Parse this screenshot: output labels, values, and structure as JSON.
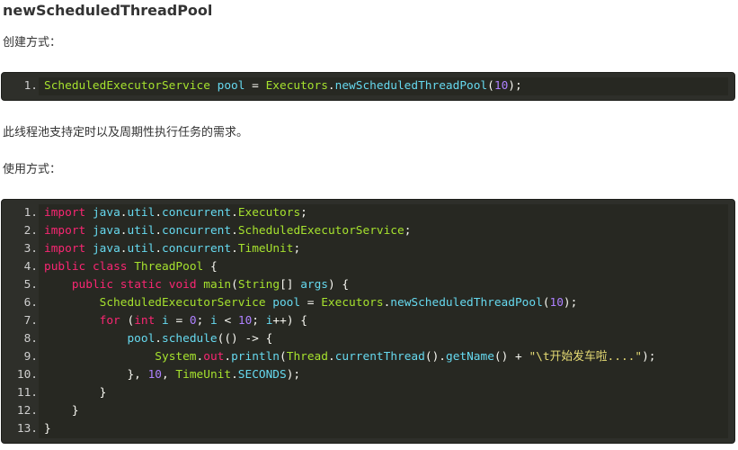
{
  "heading": "newScheduledThreadPool",
  "label_create": "创建方式：",
  "description": "此线程池支持定时以及周期性执行任务的需求。",
  "label_usage": "使用方式：",
  "snippet1": [
    {
      "no": "1.",
      "tokens": [
        {
          "t": "ScheduledExecutorService",
          "c": "type"
        },
        {
          "t": " ",
          "c": "plain"
        },
        {
          "t": "pool",
          "c": "var"
        },
        {
          "t": " = ",
          "c": "plain"
        },
        {
          "t": "Executors",
          "c": "type"
        },
        {
          "t": ".",
          "c": "plain"
        },
        {
          "t": "newScheduledThreadPool",
          "c": "var"
        },
        {
          "t": "(",
          "c": "plain"
        },
        {
          "t": "10",
          "c": "num"
        },
        {
          "t": ");",
          "c": "plain"
        }
      ]
    }
  ],
  "snippet2": [
    {
      "no": "1.",
      "tokens": [
        {
          "t": "import",
          "c": "kw"
        },
        {
          "t": " ",
          "c": "plain"
        },
        {
          "t": "java",
          "c": "var"
        },
        {
          "t": ".",
          "c": "plain"
        },
        {
          "t": "util",
          "c": "var"
        },
        {
          "t": ".",
          "c": "plain"
        },
        {
          "t": "concurrent",
          "c": "var"
        },
        {
          "t": ".",
          "c": "plain"
        },
        {
          "t": "Executors",
          "c": "type"
        },
        {
          "t": ";",
          "c": "plain"
        }
      ]
    },
    {
      "no": "2.",
      "tokens": [
        {
          "t": "import",
          "c": "kw"
        },
        {
          "t": " ",
          "c": "plain"
        },
        {
          "t": "java",
          "c": "var"
        },
        {
          "t": ".",
          "c": "plain"
        },
        {
          "t": "util",
          "c": "var"
        },
        {
          "t": ".",
          "c": "plain"
        },
        {
          "t": "concurrent",
          "c": "var"
        },
        {
          "t": ".",
          "c": "plain"
        },
        {
          "t": "ScheduledExecutorService",
          "c": "type"
        },
        {
          "t": ";",
          "c": "plain"
        }
      ]
    },
    {
      "no": "3.",
      "tokens": [
        {
          "t": "import",
          "c": "kw"
        },
        {
          "t": " ",
          "c": "plain"
        },
        {
          "t": "java",
          "c": "var"
        },
        {
          "t": ".",
          "c": "plain"
        },
        {
          "t": "util",
          "c": "var"
        },
        {
          "t": ".",
          "c": "plain"
        },
        {
          "t": "concurrent",
          "c": "var"
        },
        {
          "t": ".",
          "c": "plain"
        },
        {
          "t": "TimeUnit",
          "c": "type"
        },
        {
          "t": ";",
          "c": "plain"
        }
      ]
    },
    {
      "no": "4.",
      "tokens": [
        {
          "t": "public",
          "c": "kw"
        },
        {
          "t": " ",
          "c": "plain"
        },
        {
          "t": "class",
          "c": "kw"
        },
        {
          "t": " ",
          "c": "plain"
        },
        {
          "t": "ThreadPool",
          "c": "type"
        },
        {
          "t": " {",
          "c": "plain"
        }
      ]
    },
    {
      "no": "5.",
      "tokens": [
        {
          "t": "    ",
          "c": "plain"
        },
        {
          "t": "public",
          "c": "kw"
        },
        {
          "t": " ",
          "c": "plain"
        },
        {
          "t": "static",
          "c": "kw"
        },
        {
          "t": " ",
          "c": "plain"
        },
        {
          "t": "void",
          "c": "kw"
        },
        {
          "t": " ",
          "c": "plain"
        },
        {
          "t": "main",
          "c": "type"
        },
        {
          "t": "(",
          "c": "plain"
        },
        {
          "t": "String",
          "c": "type"
        },
        {
          "t": "[] ",
          "c": "plain"
        },
        {
          "t": "args",
          "c": "var"
        },
        {
          "t": ") {",
          "c": "plain"
        }
      ]
    },
    {
      "no": "6.",
      "tokens": [
        {
          "t": "        ",
          "c": "plain"
        },
        {
          "t": "ScheduledExecutorService",
          "c": "type"
        },
        {
          "t": " ",
          "c": "plain"
        },
        {
          "t": "pool",
          "c": "var"
        },
        {
          "t": " = ",
          "c": "plain"
        },
        {
          "t": "Executors",
          "c": "type"
        },
        {
          "t": ".",
          "c": "plain"
        },
        {
          "t": "newScheduledThreadPool",
          "c": "var"
        },
        {
          "t": "(",
          "c": "plain"
        },
        {
          "t": "10",
          "c": "num"
        },
        {
          "t": ");",
          "c": "plain"
        }
      ]
    },
    {
      "no": "7.",
      "tokens": [
        {
          "t": "        ",
          "c": "plain"
        },
        {
          "t": "for",
          "c": "kw"
        },
        {
          "t": " (",
          "c": "plain"
        },
        {
          "t": "int",
          "c": "kw"
        },
        {
          "t": " ",
          "c": "plain"
        },
        {
          "t": "i",
          "c": "var"
        },
        {
          "t": " = ",
          "c": "plain"
        },
        {
          "t": "0",
          "c": "num"
        },
        {
          "t": "; ",
          "c": "plain"
        },
        {
          "t": "i",
          "c": "var"
        },
        {
          "t": " < ",
          "c": "plain"
        },
        {
          "t": "10",
          "c": "num"
        },
        {
          "t": "; ",
          "c": "plain"
        },
        {
          "t": "i",
          "c": "var"
        },
        {
          "t": "++) {",
          "c": "plain"
        }
      ]
    },
    {
      "no": "8.",
      "tokens": [
        {
          "t": "            ",
          "c": "plain"
        },
        {
          "t": "pool",
          "c": "var"
        },
        {
          "t": ".",
          "c": "plain"
        },
        {
          "t": "schedule",
          "c": "var"
        },
        {
          "t": "(() -> {",
          "c": "plain"
        }
      ]
    },
    {
      "no": "9.",
      "tokens": [
        {
          "t": "                ",
          "c": "plain"
        },
        {
          "t": "System",
          "c": "type"
        },
        {
          "t": ".",
          "c": "plain"
        },
        {
          "t": "out",
          "c": "kw"
        },
        {
          "t": ".",
          "c": "plain"
        },
        {
          "t": "println",
          "c": "var"
        },
        {
          "t": "(",
          "c": "plain"
        },
        {
          "t": "Thread",
          "c": "type"
        },
        {
          "t": ".",
          "c": "plain"
        },
        {
          "t": "currentThread",
          "c": "var"
        },
        {
          "t": "().",
          "c": "plain"
        },
        {
          "t": "getName",
          "c": "var"
        },
        {
          "t": "() + ",
          "c": "plain"
        },
        {
          "t": "\"\\t开始发车啦....\"",
          "c": "str"
        },
        {
          "t": ");",
          "c": "plain"
        }
      ]
    },
    {
      "no": "10.",
      "tokens": [
        {
          "t": "            }, ",
          "c": "plain"
        },
        {
          "t": "10",
          "c": "num"
        },
        {
          "t": ", ",
          "c": "plain"
        },
        {
          "t": "TimeUnit",
          "c": "type"
        },
        {
          "t": ".",
          "c": "plain"
        },
        {
          "t": "SECONDS",
          "c": "var"
        },
        {
          "t": ");",
          "c": "plain"
        }
      ]
    },
    {
      "no": "11.",
      "tokens": [
        {
          "t": "        }",
          "c": "plain"
        }
      ]
    },
    {
      "no": "12.",
      "tokens": [
        {
          "t": "    }",
          "c": "plain"
        }
      ]
    },
    {
      "no": "13.",
      "tokens": [
        {
          "t": "}",
          "c": "plain"
        }
      ]
    }
  ]
}
